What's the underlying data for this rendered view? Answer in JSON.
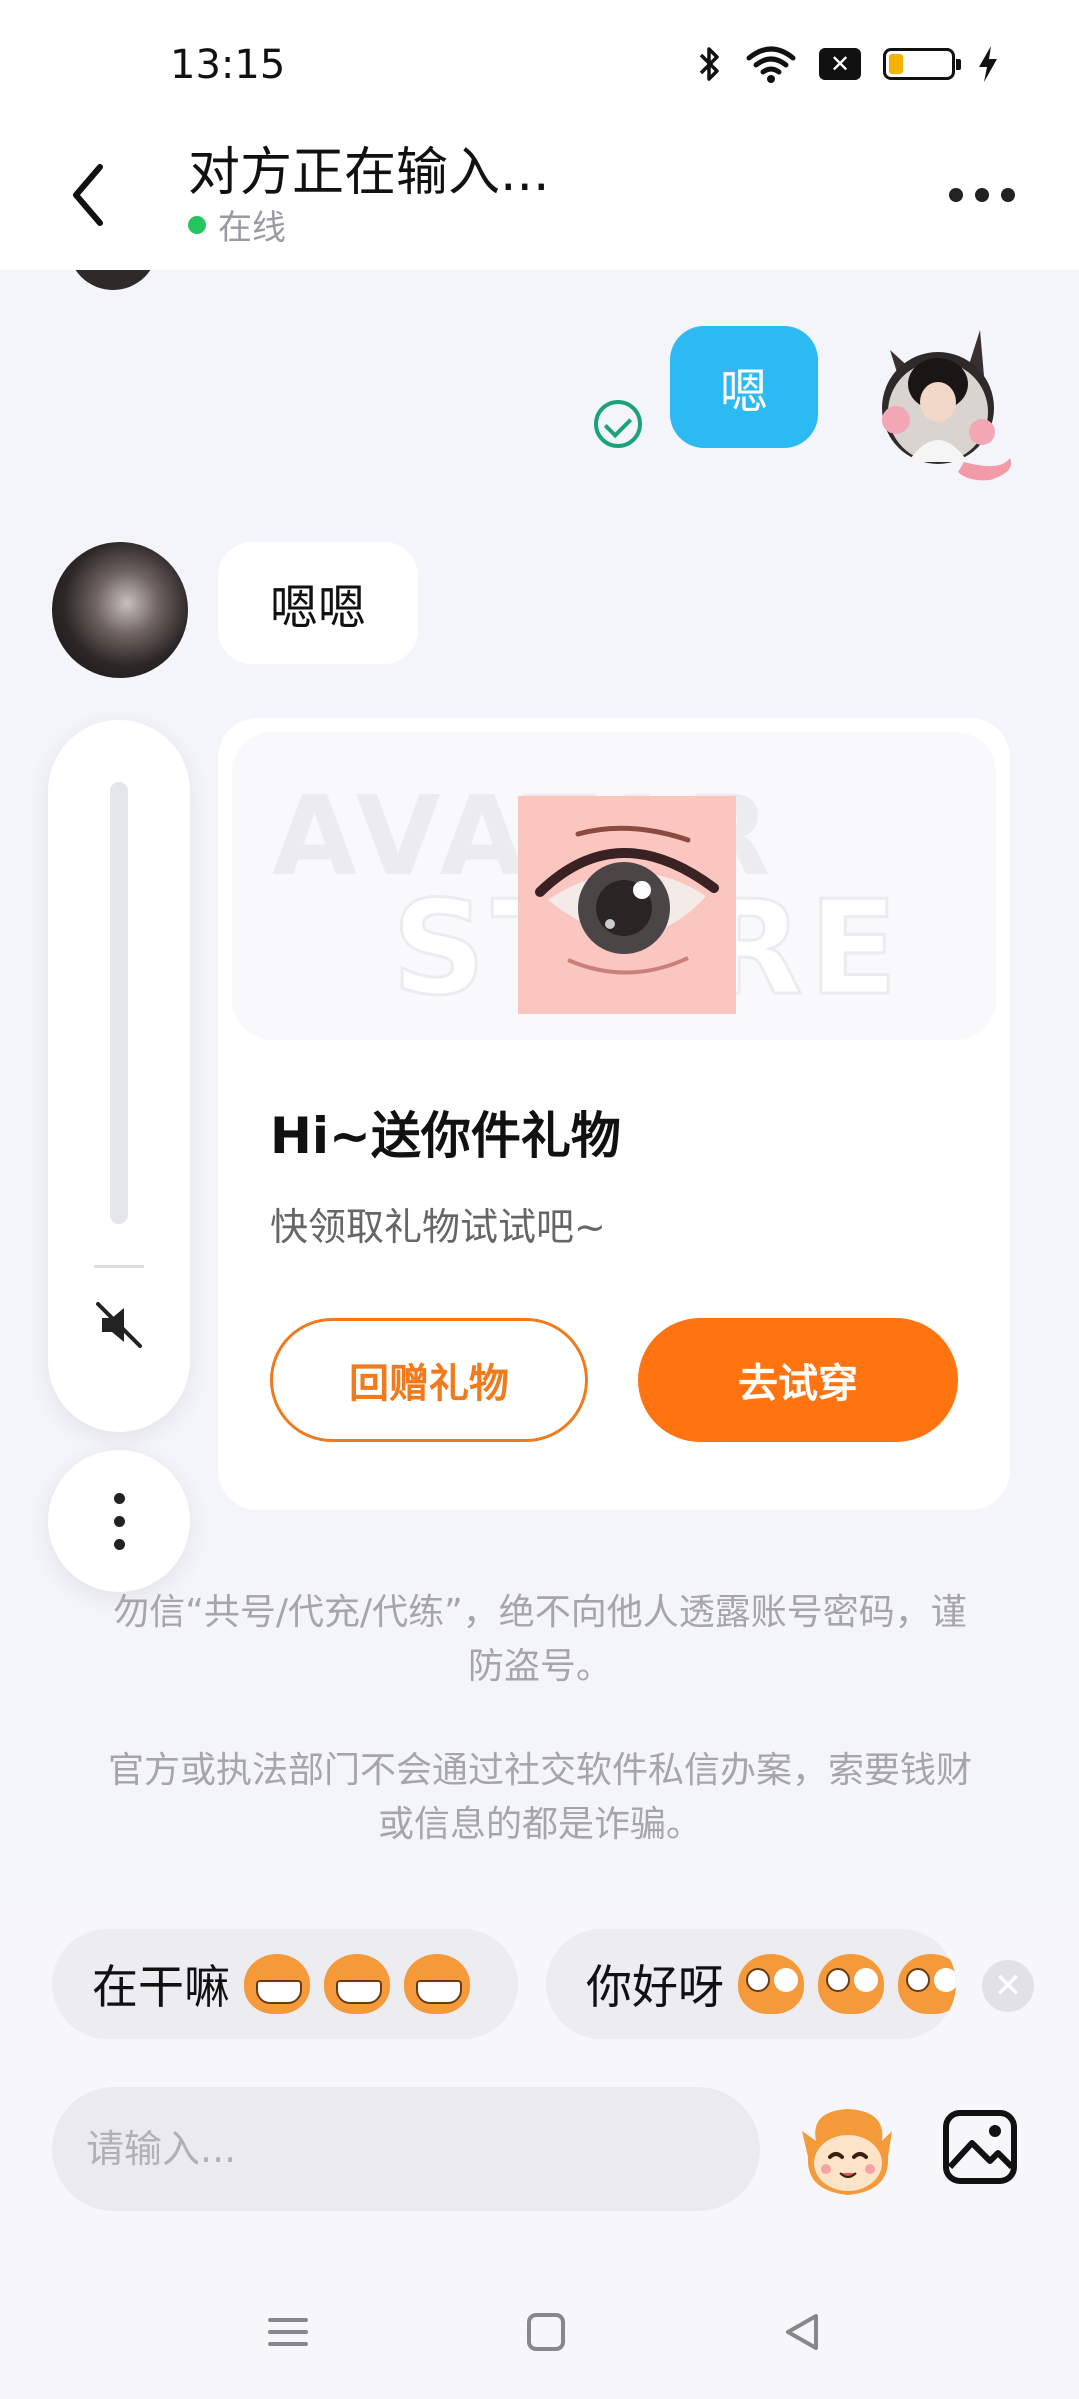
{
  "status_bar": {
    "time": "13:15",
    "icons": [
      "bluetooth-icon",
      "wifi-icon",
      "x-box-icon",
      "battery-icon",
      "charging-bolt-icon"
    ],
    "battery_color": "#f5b301"
  },
  "header": {
    "title": "对方正在输入...",
    "online_status": "在线",
    "online_color": "#22c55e"
  },
  "messages": [
    {
      "side": "sent",
      "text": "嗯",
      "bubble_color": "#2dbaf3",
      "read": true
    },
    {
      "side": "received",
      "text": "嗯嗯"
    }
  ],
  "gift_card": {
    "title": "Hi~送你件礼物",
    "subtitle": "快领取礼物试试吧~",
    "return_button": "回赠礼物",
    "try_button": "去试穿",
    "accent_color": "#ff7411",
    "watermark_line1": "AVATAR",
    "watermark_line2": "STORE"
  },
  "notices": [
    "勿信“共号/代充/代练”，绝不向他人透露账号密码，谨防盗号。",
    "官方或执法部门不会通过社交软件私信办案，索要钱财或信息的都是诈骗。"
  ],
  "quick_replies": [
    {
      "text": "在干嘛"
    },
    {
      "text": "你好呀"
    }
  ],
  "input": {
    "placeholder": "请输入..."
  }
}
